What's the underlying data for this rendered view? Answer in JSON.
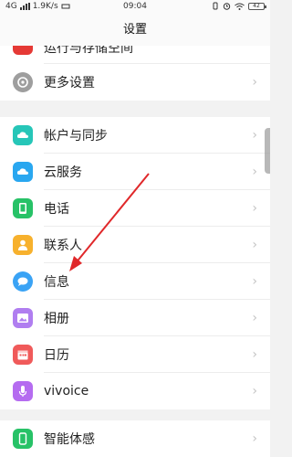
{
  "status_bar": {
    "network": "4G",
    "speed": "1.9K/s",
    "time": "09:04",
    "battery": "42"
  },
  "header": {
    "title": "设置"
  },
  "rows": [
    {
      "label": "运行与存储空间",
      "icon": "partial-icon",
      "color": "#e53935"
    },
    {
      "label": "更多设置",
      "icon": "gear-icon",
      "color": "#9e9e9e"
    },
    {
      "label": "帐户与同步",
      "icon": "cloud-sync-icon",
      "color": "#26c6b8"
    },
    {
      "label": "云服务",
      "icon": "cloud-icon",
      "color": "#29a7f0"
    },
    {
      "label": "电话",
      "icon": "phone-icon",
      "color": "#27c267"
    },
    {
      "label": "联系人",
      "icon": "contact-icon",
      "color": "#f7b12d"
    },
    {
      "label": "信息",
      "icon": "message-icon",
      "color": "#3aa3f5"
    },
    {
      "label": "相册",
      "icon": "album-icon",
      "color": "#b07ef0"
    },
    {
      "label": "日历",
      "icon": "calendar-icon",
      "color": "#f05a5a"
    },
    {
      "label": "vivoice",
      "icon": "mic-icon",
      "color": "#b56cf0"
    },
    {
      "label": "智能体感",
      "icon": "phone-gesture-icon",
      "color": "#27c267"
    }
  ],
  "chevron": "›"
}
